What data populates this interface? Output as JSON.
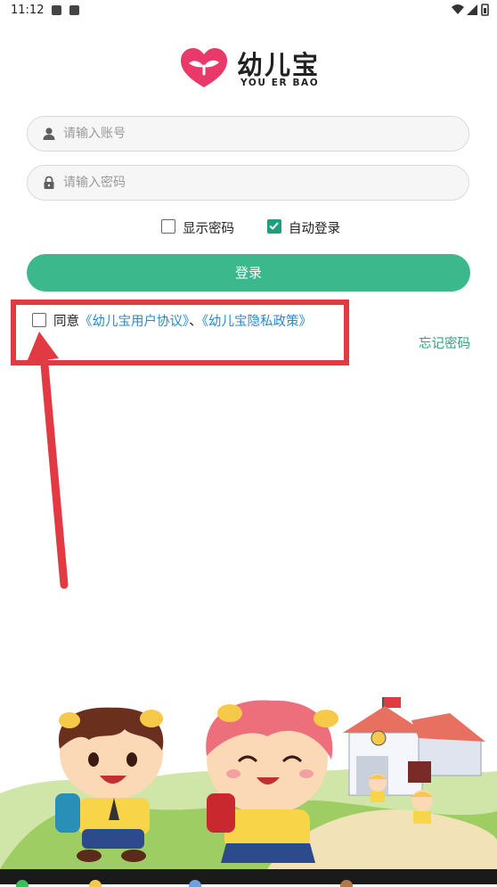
{
  "status_bar": {
    "time": "11:12"
  },
  "logo": {
    "title_cn": "幼儿宝",
    "title_en": "YOU ER BAO"
  },
  "login_form": {
    "account_placeholder": "请输入账号",
    "password_placeholder": "请输入密码",
    "show_password_label": "显示密码",
    "show_password_checked": false,
    "auto_login_label": "自动登录",
    "auto_login_checked": true,
    "login_button_label": "登录"
  },
  "agreement": {
    "prefix": "同意",
    "user_agreement_link": "《幼儿宝用户协议》",
    "separator": "、",
    "privacy_policy_link": "《幼儿宝隐私政策》",
    "checked": false
  },
  "forgot_password_label": "忘记密码",
  "colors": {
    "primary_green": "#3bb98c",
    "link_blue": "#2b89c9",
    "forgot_green": "#2fa37c",
    "annotation_red": "#e23a43"
  },
  "icons": [
    "user-icon",
    "lock-icon",
    "heart-sprout-logo-icon",
    "signal-icon",
    "wifi-icon",
    "battery-icon"
  ]
}
